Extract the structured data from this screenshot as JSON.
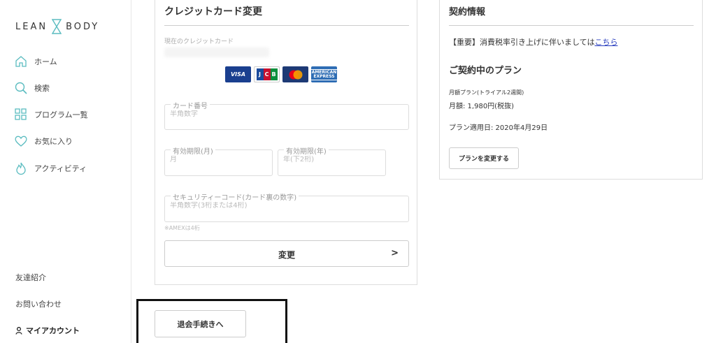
{
  "sidebar": {
    "logo_left": "LEAN",
    "logo_right": "BODY",
    "nav": [
      {
        "label": "ホーム"
      },
      {
        "label": "検索"
      },
      {
        "label": "プログラム一覧"
      },
      {
        "label": "お気に入り"
      },
      {
        "label": "アクティビティ"
      }
    ],
    "footer": {
      "referral": "友達紹介",
      "contact": "お問い合わせ",
      "account": "マイアカウント"
    },
    "accent_color": "#5bbcc0"
  },
  "card_panel": {
    "title": "クレジットカード変更",
    "current_card_label": "現在のクレジットカード",
    "brands": [
      {
        "name": "VISA"
      },
      {
        "name": "JCB"
      },
      {
        "name": "MasterCard"
      },
      {
        "name": "AMERICAN EXPRESS"
      }
    ],
    "card_number": {
      "legend": "カード番号",
      "placeholder": "半角数字"
    },
    "exp_month": {
      "legend": "有効期限(月)",
      "placeholder": "月"
    },
    "exp_year": {
      "legend": "有効期限(年)",
      "placeholder": "年(下2桁)"
    },
    "security_code": {
      "legend": "セキュリティーコード(カード裏の数字)",
      "placeholder": "半角数字(3桁または4桁)"
    },
    "amex_note": "※AMEXは4桁",
    "submit_label": "変更",
    "submit_arrow": ">"
  },
  "contract_panel": {
    "title": "契約情報",
    "notice_text": "【重要】消費税率引き上げに伴いましては",
    "notice_link": "こちら",
    "plan_heading": "ご契約中のプラン",
    "plan_name": "月額プラン(トライアル2週間)",
    "price": "月額: 1,980円(税抜)",
    "start_date": "プラン適用日: 2020年4月29日",
    "change_plan_label": "プランを変更する"
  },
  "withdraw": {
    "label": "退会手続きへ"
  }
}
